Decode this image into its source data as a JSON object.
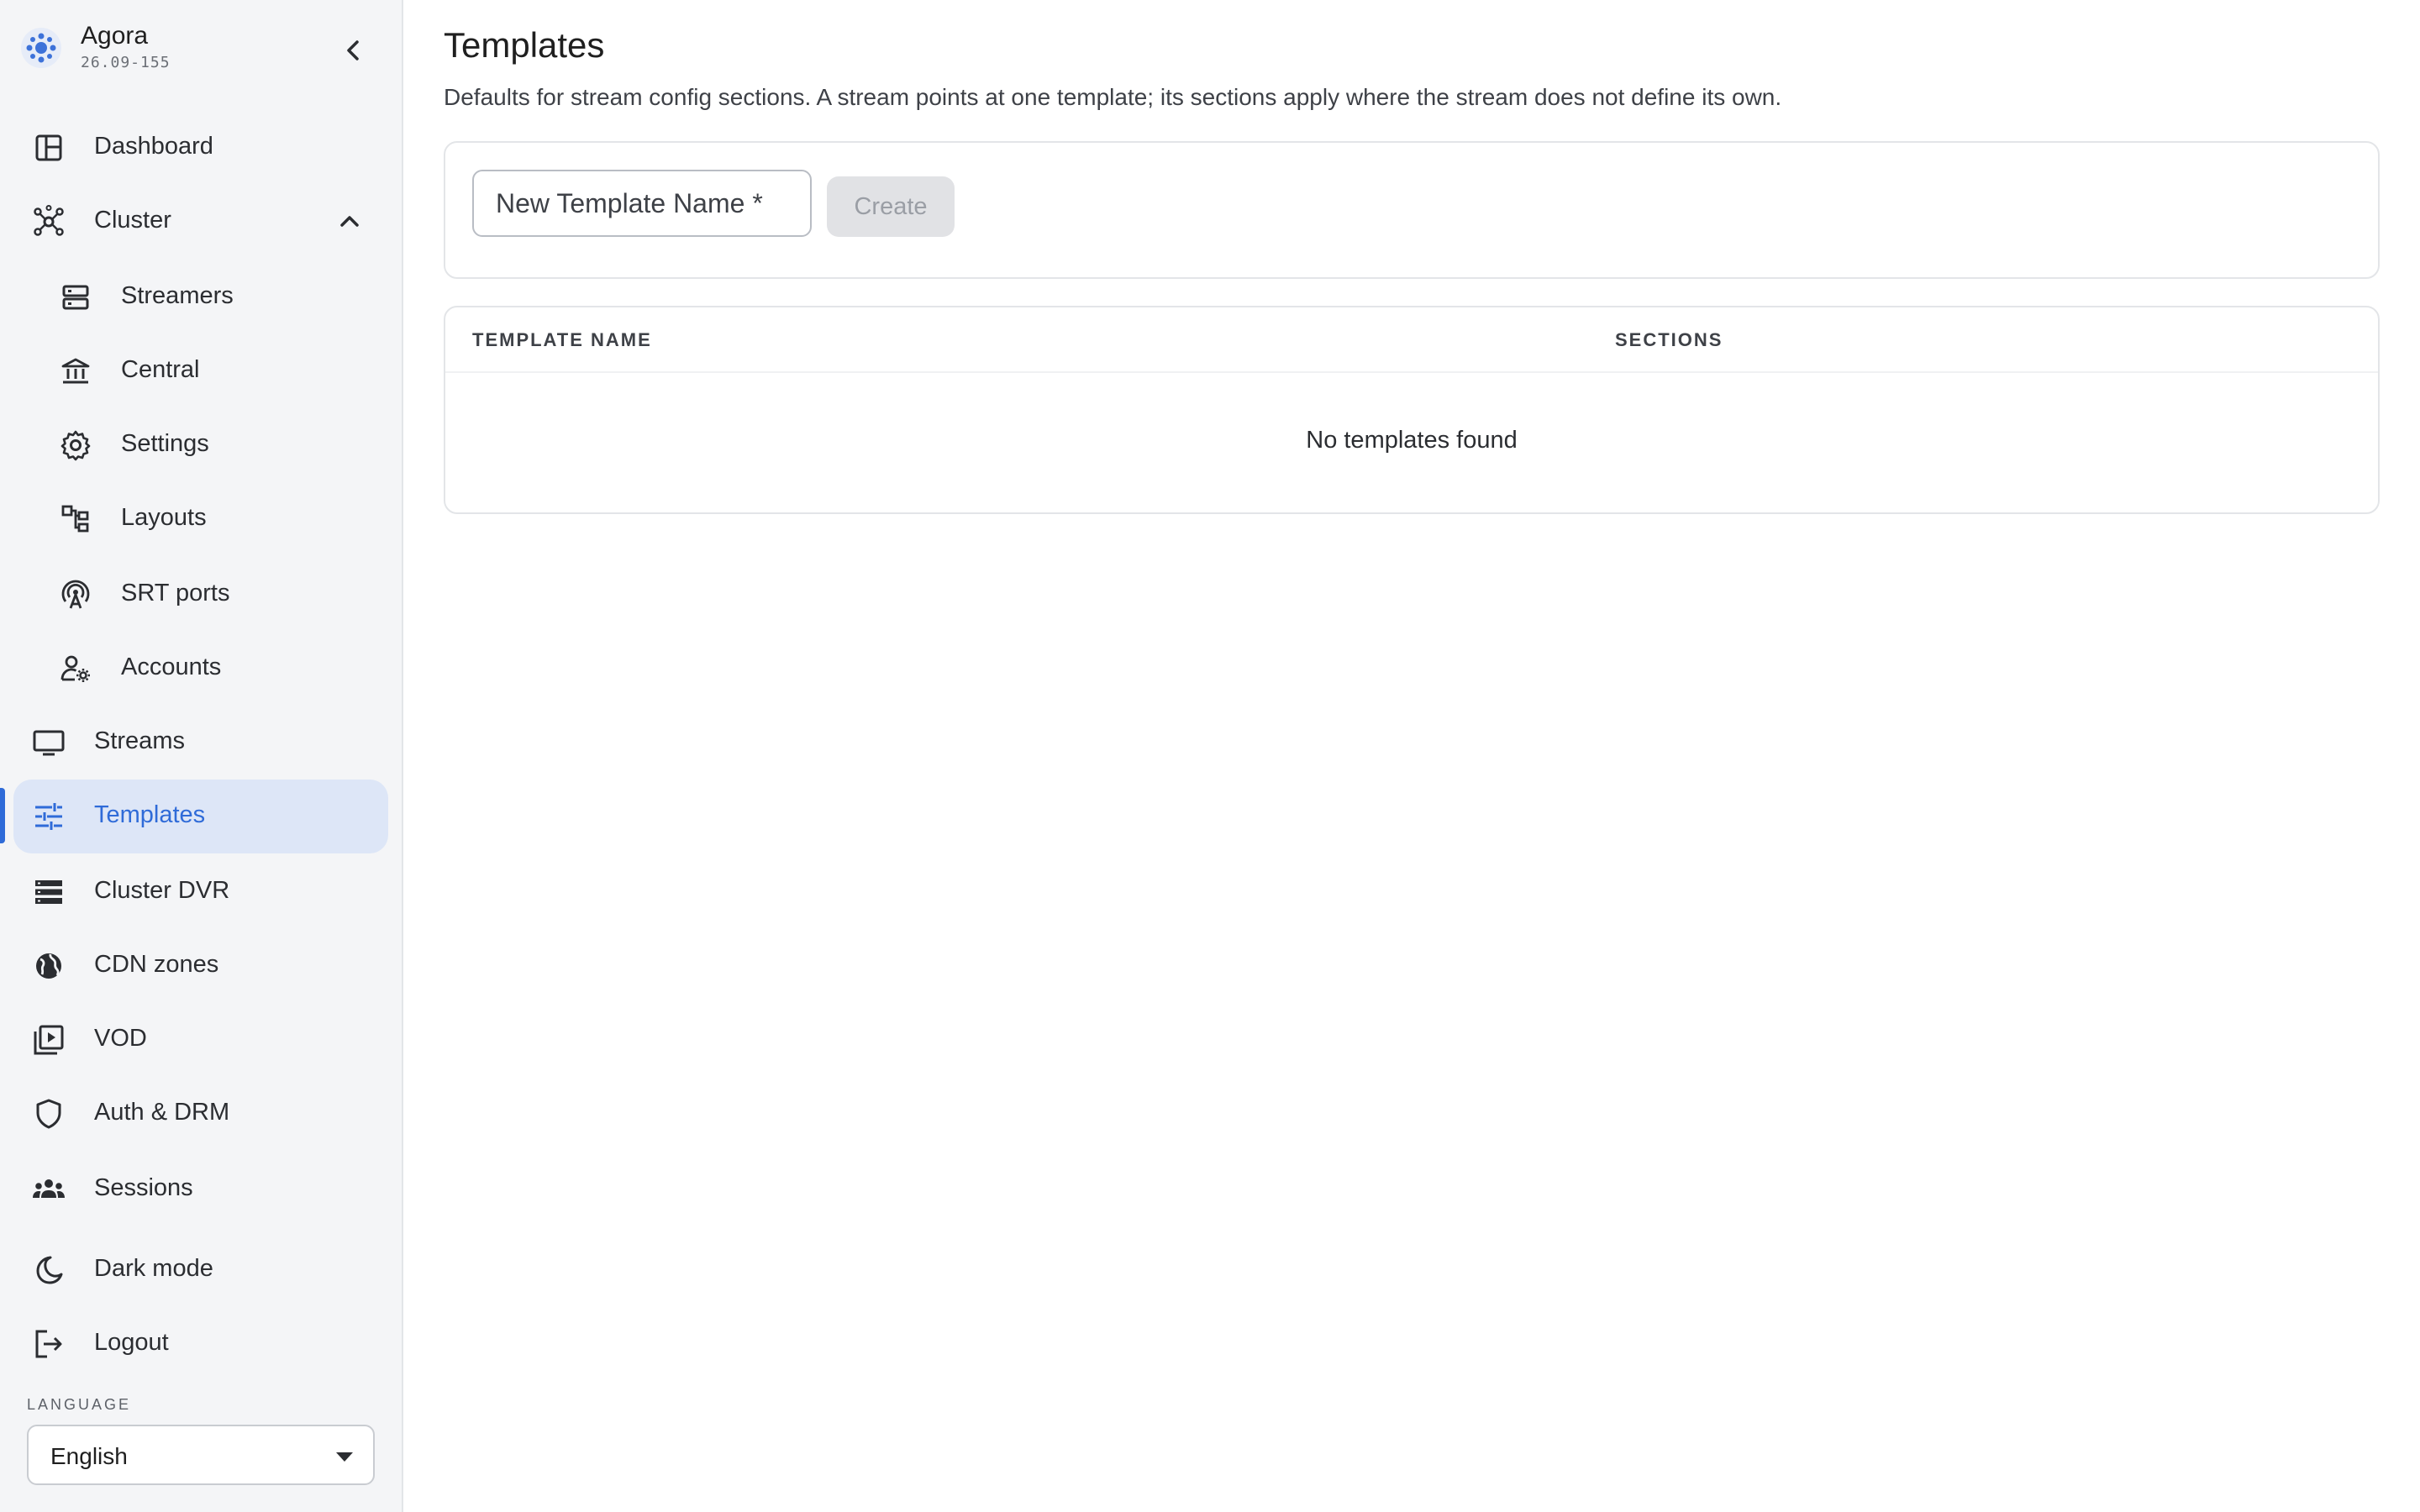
{
  "app": {
    "name": "Agora",
    "version": "26.09-155"
  },
  "sidebar": {
    "items": [
      {
        "label": "Dashboard",
        "icon": "dashboard-icon"
      },
      {
        "label": "Cluster",
        "icon": "cluster-icon",
        "expanded": true
      },
      {
        "label": "Streamers",
        "icon": "streamers-icon"
      },
      {
        "label": "Central",
        "icon": "central-icon"
      },
      {
        "label": "Settings",
        "icon": "gear-icon"
      },
      {
        "label": "Layouts",
        "icon": "layouts-icon"
      },
      {
        "label": "SRT ports",
        "icon": "antenna-icon"
      },
      {
        "label": "Accounts",
        "icon": "user-gear-icon"
      },
      {
        "label": "Streams",
        "icon": "monitor-icon"
      },
      {
        "label": "Templates",
        "icon": "sliders-icon",
        "active": true
      },
      {
        "label": "Cluster DVR",
        "icon": "storage-icon"
      },
      {
        "label": "CDN zones",
        "icon": "globe-icon"
      },
      {
        "label": "VOD",
        "icon": "video-library-icon"
      },
      {
        "label": "Auth & DRM",
        "icon": "shield-icon"
      },
      {
        "label": "Sessions",
        "icon": "people-icon"
      },
      {
        "label": "Dark mode",
        "icon": "moon-icon"
      },
      {
        "label": "Logout",
        "icon": "logout-icon"
      }
    ],
    "language": {
      "label": "LANGUAGE",
      "value": "English"
    }
  },
  "main": {
    "title": "Templates",
    "description": "Defaults for stream config sections. A stream points at one template; its sections apply where the stream does not define its own.",
    "create": {
      "placeholder": "New Template Name *",
      "value": "",
      "button_label": "Create"
    },
    "table": {
      "columns": [
        "TEMPLATE NAME",
        "SECTIONS"
      ],
      "rows": [],
      "empty_text": "No templates found"
    }
  },
  "colors": {
    "accent": "#2f6bd8",
    "active_bg": "#dde6f7",
    "sidebar_bg": "#f4f5f7"
  }
}
